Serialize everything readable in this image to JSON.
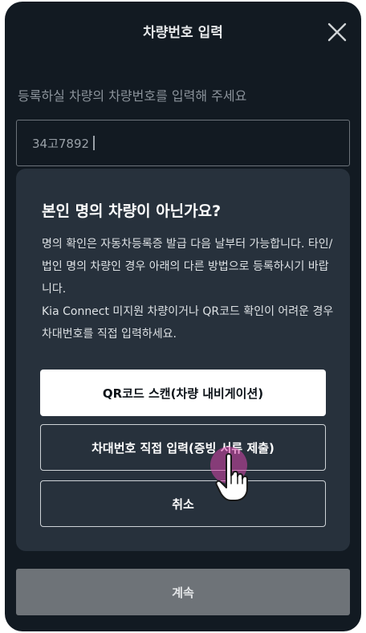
{
  "header": {
    "title": "차량번호 입력",
    "close_icon": "close-icon"
  },
  "form": {
    "prompt": "등록하실 차량의 차량번호를 입력해 주세요",
    "plate_value": "34고7892"
  },
  "dialog": {
    "title": "본인 명의 차량이 아닌가요?",
    "body": "명의 확인은 자동차등록증 발급 다음 날부터 가능합니다. 타인/법인 명의 차량인 경우 아래의 다른 방법으로 등록하시기 바랍니다.\nKia Connect 미지원 차량이거나 QR코드 확인이 어려운 경우 차대번호를 직접 입력하세요.",
    "buttons": {
      "qr_scan": "QR코드 스캔(차량 내비게이션)",
      "manual_vin": "차대번호 직접 입력(증빙 서류 제출)",
      "cancel": "취소"
    }
  },
  "footer": {
    "continue_label": "계속"
  },
  "colors": {
    "background": "#121a22",
    "dialog": "#27313c",
    "primary_button": "#ffffff",
    "disabled_button": "#6e7378",
    "tap_highlight": "#d646aa"
  }
}
